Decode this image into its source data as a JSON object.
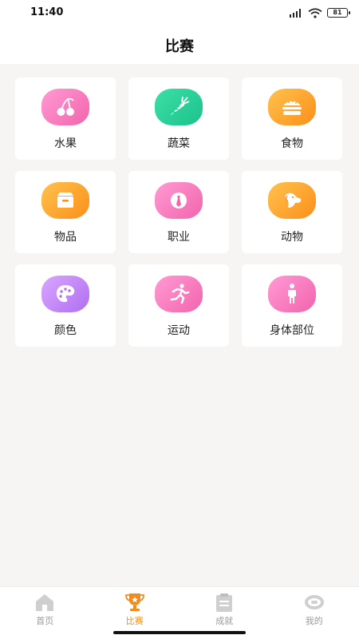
{
  "status": {
    "time": "11:40",
    "battery": "81"
  },
  "header": {
    "title": "比赛"
  },
  "categories": [
    {
      "label": "水果",
      "icon": "cherry-icon",
      "color": "#f264ad"
    },
    {
      "label": "蔬菜",
      "icon": "carrot-icon",
      "color": "#1cc28c"
    },
    {
      "label": "食物",
      "icon": "burger-icon",
      "color": "#fb8f1b"
    },
    {
      "label": "物品",
      "icon": "box-icon",
      "color": "#fb8f1b"
    },
    {
      "label": "职业",
      "icon": "tie-icon",
      "color": "#f264ad"
    },
    {
      "label": "动物",
      "icon": "dog-icon",
      "color": "#fb8f1b"
    },
    {
      "label": "颜色",
      "icon": "palette-icon",
      "color": "#b06ef0"
    },
    {
      "label": "运动",
      "icon": "runner-icon",
      "color": "#f264ad"
    },
    {
      "label": "身体部位",
      "icon": "person-icon",
      "color": "#f264ad"
    }
  ],
  "tabs": [
    {
      "label": "首页",
      "icon": "home-icon",
      "active": false
    },
    {
      "label": "比赛",
      "icon": "trophy-icon",
      "active": true
    },
    {
      "label": "成就",
      "icon": "clipboard-icon",
      "active": false
    },
    {
      "label": "我的",
      "icon": "profile-icon",
      "active": false
    }
  ],
  "colors": {
    "accent": "#f08c1e",
    "inactive": "#c8c8c8"
  }
}
